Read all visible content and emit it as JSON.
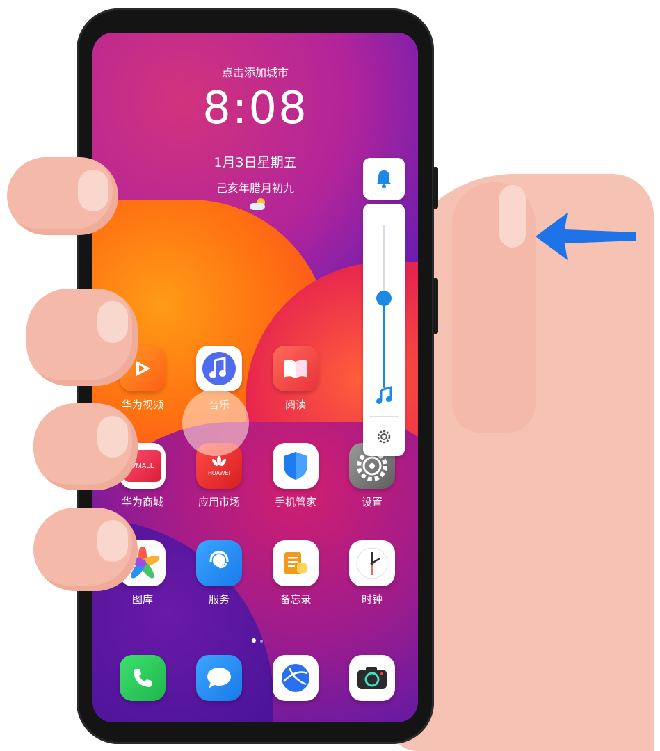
{
  "lockscreen": {
    "city_prompt": "点击添加城市",
    "time": "8:08",
    "date": "1月3日星期五",
    "lunar_date": "己亥年腊月初九",
    "weather_icon": "partly-cloudy-icon"
  },
  "apps": {
    "row1": [
      {
        "label": "华为视频",
        "icon": "huawei-video-icon",
        "color": "#ff7a1a"
      },
      {
        "label": "音乐",
        "icon": "music-icon",
        "color": "#4f6cf0"
      },
      {
        "label": "阅读",
        "icon": "book-icon",
        "color": "#f04a4a"
      }
    ],
    "row2": [
      {
        "label": "华为商城",
        "icon": "vmall-icon",
        "badge": "VMALL",
        "color": "#e8364b"
      },
      {
        "label": "应用市场",
        "icon": "appgallery-icon",
        "badge": "HUAWEI",
        "color": "#e52d2d"
      },
      {
        "label": "手机管家",
        "icon": "shield-icon",
        "color": "#1e7bf0"
      },
      {
        "label": "设置",
        "icon": "gear-icon",
        "color": "#707070"
      }
    ],
    "row3": [
      {
        "label": "图库",
        "icon": "gallery-icon",
        "color": "#ff5a4a"
      },
      {
        "label": "服务",
        "icon": "service-icon",
        "color": "#1e8ff0"
      },
      {
        "label": "备忘录",
        "icon": "notepad-icon",
        "color": "#f39a1c"
      },
      {
        "label": "时钟",
        "icon": "clock-icon",
        "color": "#333333"
      }
    ],
    "dock": [
      {
        "icon": "phone-icon",
        "color": "#2dcc5a"
      },
      {
        "icon": "messages-icon",
        "color": "#1e8ff0"
      },
      {
        "icon": "browser-icon",
        "color": "#2a6ff0"
      },
      {
        "icon": "camera-icon",
        "color": "#2b2b2b"
      }
    ]
  },
  "volume_panel": {
    "mode_icon": "bell-icon",
    "level": 0.55,
    "stream_icon": "music-note-icon",
    "settings_icon": "gear-icon",
    "accent": "#1e88e5"
  },
  "page_indicator": {
    "current": 1,
    "total": 2
  },
  "gesture_arrow": {
    "icon": "left-arrow-icon",
    "color": "#1e73e8"
  }
}
